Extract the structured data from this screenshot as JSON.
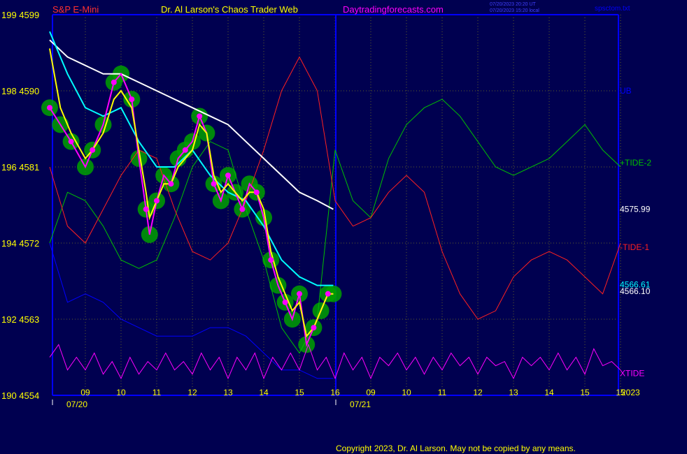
{
  "header": {
    "symbol": "S&P E-Mini",
    "title": "Dr. Al Larson's Chaos Trader Web",
    "site": "Daytradingforecasts.com",
    "timestamp_ut": "07/20/2023 20:20 UT",
    "timestamp_local": "07/20/2023 15:20 local",
    "filename": "spsctom.txt"
  },
  "footer": {
    "copyright": "Copyright 2023, Dr. Al Larson. May not be copied by any means."
  },
  "colors": {
    "background": "#000050",
    "grid": "#c0c000",
    "axis": "#0000ff",
    "price": "#ff00ff",
    "ma_fast": "#ffff00",
    "ma_mid": "#00ffff",
    "ma_slow": "#ffffff",
    "tide_plus": "#00c000",
    "tide_minus": "#ff2020",
    "xtide": "#ff00ff",
    "ub": "#0000ff",
    "highlight": "#00a000"
  },
  "chart_data": {
    "type": "line",
    "ylim": [
      4554,
      4599
    ],
    "y_ticks": [
      {
        "label": "199 4599",
        "value": 4599
      },
      {
        "label": "198 4590",
        "value": 4590
      },
      {
        "label": "196 4581",
        "value": 4581
      },
      {
        "label": "194 4572",
        "value": 4572
      },
      {
        "label": "192 4563",
        "value": 4563
      },
      {
        "label": "190 4554",
        "value": 4554
      }
    ],
    "x_ticks": [
      "09",
      "10",
      "11",
      "12",
      "13",
      "14",
      "15",
      "16",
      "09",
      "10",
      "11",
      "12",
      "13",
      "14",
      "15",
      "15"
    ],
    "date_labels": [
      "07/20",
      "07/21"
    ],
    "year_label": "2023",
    "right_labels": [
      {
        "text": "UB",
        "value": 4590,
        "color": "#0000ff"
      },
      {
        "text": "+TIDE-2",
        "value": 4581.5,
        "color": "#00c000"
      },
      {
        "text": "4575.99",
        "value": 4576,
        "color": "#ffffff"
      },
      {
        "text": "-TIDE-1",
        "value": 4571.5,
        "color": "#ff2020"
      },
      {
        "text": "4566.61",
        "value": 4567.1,
        "color": "#00ffff"
      },
      {
        "text": "4566.10",
        "value": 4566.3,
        "color": "#ffffff"
      },
      {
        "text": "XTIDE",
        "value": 4556.6,
        "color": "#ff00ff"
      }
    ],
    "series": [
      {
        "name": "price",
        "x": [
          0,
          0.3,
          0.6,
          1,
          1.2,
          1.5,
          1.8,
          2,
          2.3,
          2.5,
          2.7,
          2.8,
          3,
          3.2,
          3.4,
          3.6,
          3.8,
          4,
          4.2,
          4.4,
          4.6,
          4.8,
          5,
          5.2,
          5.4,
          5.6,
          5.8,
          6,
          6.2,
          6.4,
          6.6,
          6.8,
          7,
          7.2,
          7.4,
          7.6,
          7.8,
          7.95
        ],
        "y": [
          4588,
          4586,
          4584,
          4581,
          4583,
          4586,
          4591,
          4592,
          4589,
          4582,
          4576,
          4573,
          4577,
          4580,
          4579,
          4582,
          4583,
          4584,
          4587,
          4585,
          4579,
          4577,
          4580,
          4578,
          4576,
          4579,
          4578,
          4575,
          4570,
          4567,
          4565,
          4563,
          4566,
          4560,
          4562,
          4564,
          4566,
          4566
        ]
      },
      {
        "name": "ma_fast",
        "x": [
          0,
          0.3,
          0.6,
          1,
          1.2,
          1.5,
          1.8,
          2,
          2.3,
          2.5,
          2.7,
          2.8,
          3,
          3.2,
          3.4,
          3.6,
          3.8,
          4,
          4.2,
          4.4,
          4.6,
          4.8,
          5,
          5.2,
          5.4,
          5.6,
          5.8,
          6,
          6.2,
          6.4,
          6.6,
          6.8,
          7,
          7.2,
          7.4,
          7.6,
          7.8,
          7.95
        ],
        "y": [
          4595,
          4588,
          4585,
          4582,
          4583,
          4585,
          4589,
          4590,
          4588,
          4583,
          4578,
          4575,
          4577,
          4579,
          4579,
          4581,
          4582,
          4583,
          4586,
          4585,
          4580,
          4578,
          4579,
          4578,
          4577,
          4578,
          4578,
          4576,
          4571,
          4568,
          4566,
          4564,
          4565,
          4561,
          4562,
          4564,
          4566,
          4566
        ]
      },
      {
        "name": "ma_mid",
        "x": [
          0,
          0.5,
          1,
          1.5,
          2,
          2.5,
          3,
          3.5,
          4,
          4.5,
          5,
          5.5,
          6,
          6.5,
          7,
          7.5,
          7.95
        ],
        "y": [
          4597,
          4592,
          4588,
          4587,
          4588,
          4584,
          4581,
          4581,
          4583,
          4580,
          4578,
          4577,
          4574,
          4570,
          4568,
          4567,
          4567
        ]
      },
      {
        "name": "ma_slow",
        "x": [
          0,
          0.5,
          1,
          1.5,
          2,
          2.5,
          3,
          3.5,
          4,
          4.5,
          5,
          5.5,
          6,
          6.5,
          7,
          7.5,
          7.95
        ],
        "y": [
          4596,
          4594,
          4593,
          4592,
          4592,
          4591,
          4590,
          4589,
          4588,
          4587,
          4586,
          4584,
          4582,
          4580,
          4578,
          4577,
          4576
        ]
      },
      {
        "name": "+TIDE-2",
        "x": [
          0,
          0.5,
          1,
          1.5,
          2,
          2.5,
          3,
          3.5,
          4,
          4.5,
          5,
          5.5,
          6,
          6.5,
          7,
          7.5,
          8,
          8.5,
          9,
          9.5,
          10,
          10.5,
          11,
          11.5,
          12,
          12.5,
          13,
          13.5,
          14,
          14.5,
          15,
          15.5,
          16
        ],
        "y": [
          4572,
          4578,
          4577,
          4574,
          4570,
          4569,
          4570,
          4575,
          4581,
          4584,
          4583,
          4576,
          4570,
          4562,
          4559,
          4563,
          4583,
          4577,
          4575,
          4582,
          4586,
          4588,
          4589,
          4587,
          4584,
          4581,
          4580,
          4581,
          4582,
          4584,
          4586,
          4583,
          4581
        ]
      },
      {
        "name": "-TIDE-1",
        "x": [
          0,
          0.5,
          1,
          1.5,
          2,
          2.5,
          3,
          3.5,
          4,
          4.5,
          5,
          5.5,
          6,
          6.5,
          7,
          7.5,
          8,
          8.5,
          9,
          9.5,
          10,
          10.5,
          11,
          11.5,
          12,
          12.5,
          13,
          13.5,
          14,
          14.5,
          15,
          15.5,
          16
        ],
        "y": [
          4581,
          4574,
          4572,
          4576,
          4580,
          4583,
          4582,
          4576,
          4571,
          4570,
          4572,
          4577,
          4583,
          4590,
          4594,
          4590,
          4577,
          4574,
          4575,
          4578,
          4580,
          4578,
          4571,
          4566,
          4563,
          4564,
          4568,
          4570,
          4571,
          4570,
          4568,
          4566,
          4572
        ]
      },
      {
        "name": "UB",
        "x": [
          0,
          0.5,
          1,
          1.5,
          2,
          2.5,
          3,
          3.5,
          4,
          4.5,
          5,
          5.5,
          6,
          6.5,
          7,
          7.5,
          7.95
        ],
        "y": [
          4572,
          4565,
          4566,
          4565,
          4563,
          4562,
          4561,
          4561,
          4561,
          4562,
          4562,
          4561,
          4559,
          4557,
          4557,
          4556,
          4556
        ]
      },
      {
        "name": "XTIDE",
        "x": [
          0,
          0.25,
          0.5,
          0.75,
          1,
          1.25,
          1.5,
          1.75,
          2,
          2.25,
          2.5,
          2.75,
          3,
          3.25,
          3.5,
          3.75,
          4,
          4.25,
          4.5,
          4.75,
          5,
          5.25,
          5.5,
          5.75,
          6,
          6.25,
          6.5,
          6.75,
          7,
          7.25,
          7.5,
          7.75,
          8,
          8.25,
          8.5,
          8.75,
          9,
          9.25,
          9.5,
          9.75,
          10,
          10.25,
          10.5,
          10.75,
          11,
          11.25,
          11.5,
          11.75,
          12,
          12.25,
          12.5,
          12.75,
          13,
          13.25,
          13.5,
          13.75,
          14,
          14.25,
          14.5,
          14.75,
          15,
          15.25,
          15.5,
          15.75,
          16
        ],
        "y": [
          4558.5,
          4560,
          4557,
          4558.5,
          4557,
          4559,
          4556.5,
          4558,
          4556,
          4558.5,
          4556.5,
          4558,
          4557,
          4559,
          4557,
          4558,
          4556.5,
          4559,
          4557,
          4558.5,
          4556,
          4558.5,
          4557,
          4559,
          4556,
          4558.5,
          4557,
          4559,
          4557,
          4560,
          4557,
          4558.5,
          4556,
          4559,
          4557,
          4558.5,
          4556,
          4558.5,
          4557.5,
          4559,
          4557,
          4558.5,
          4556.5,
          4558.5,
          4557,
          4559,
          4557.5,
          4558.5,
          4556.5,
          4558.5,
          4557.5,
          4558,
          4556,
          4558.5,
          4557.5,
          4558.5,
          4557,
          4559,
          4557,
          4558.5,
          4556.5,
          4559.5,
          4557.5,
          4558,
          4557
        ]
      }
    ]
  }
}
